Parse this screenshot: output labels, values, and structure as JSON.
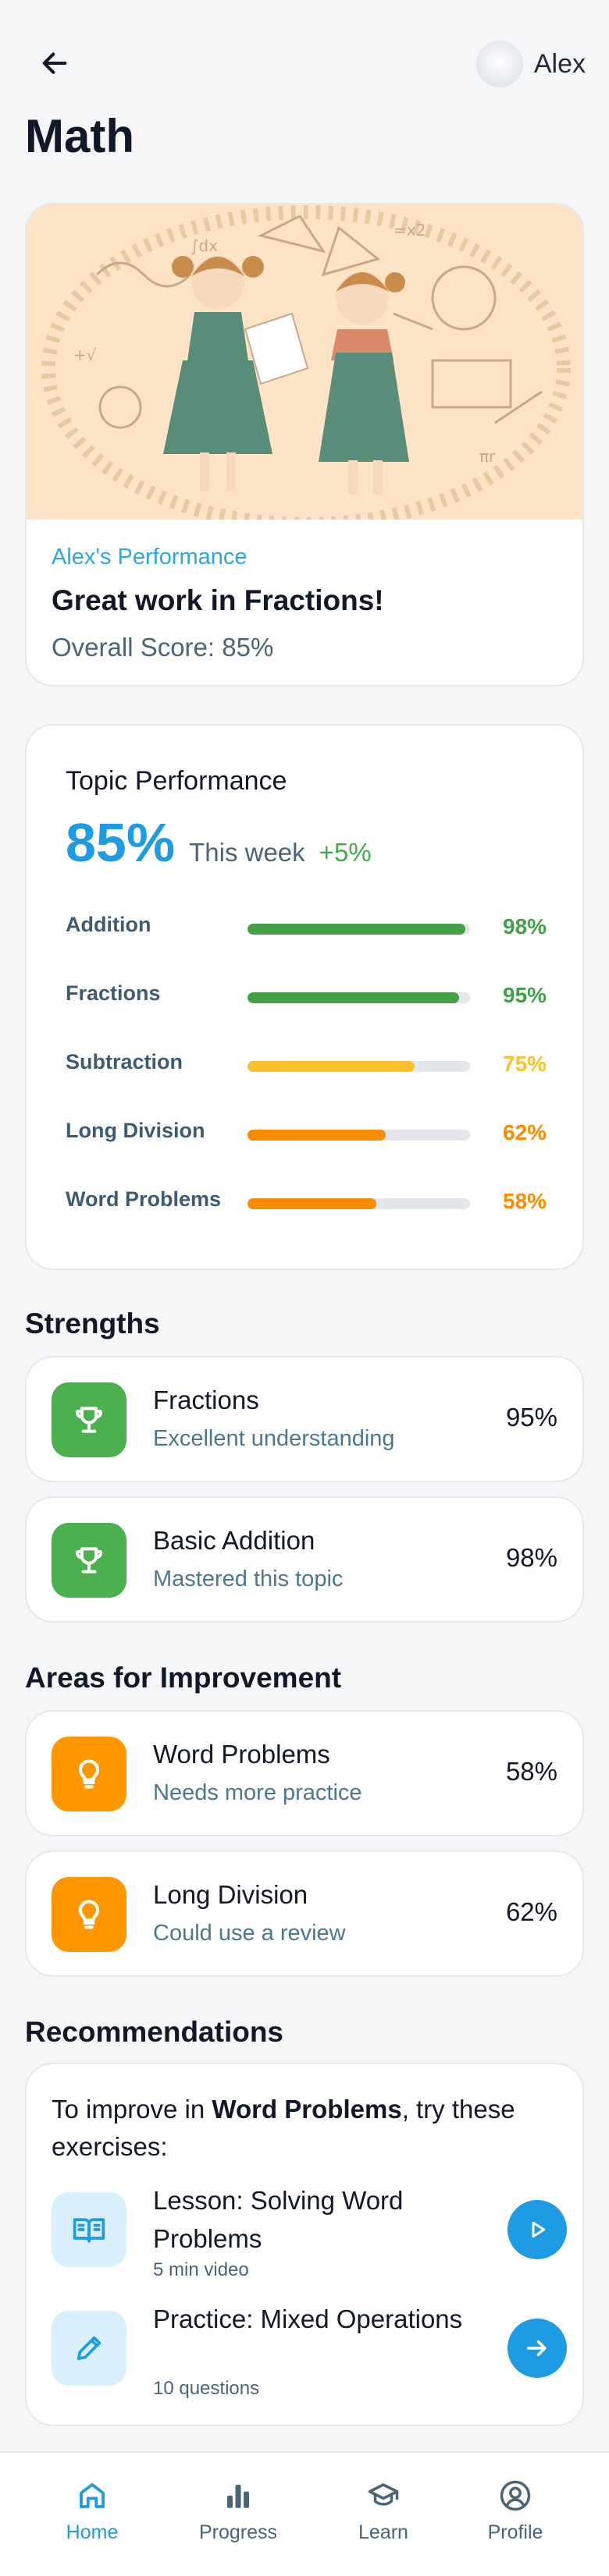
{
  "header": {
    "user_name": "Alex"
  },
  "page_title": "Math",
  "hero": {
    "subtitle": "Alex's Performance",
    "title": "Great work in Fractions!",
    "score": "Overall Score: 85%"
  },
  "topic_performance": {
    "title": "Topic Performance",
    "score": "85%",
    "week_label": "This week",
    "week_delta": "+5%",
    "items": [
      {
        "label": "Addition",
        "pct": "98%",
        "value": 98,
        "color": "#43a047"
      },
      {
        "label": "Fractions",
        "pct": "95%",
        "value": 95,
        "color": "#43a047"
      },
      {
        "label": "Subtraction",
        "pct": "75%",
        "value": 75,
        "color": "#fbc02d"
      },
      {
        "label": "Long Division",
        "pct": "62%",
        "value": 62,
        "color": "#fb8c00"
      },
      {
        "label": "Word Problems",
        "pct": "58%",
        "value": 58,
        "color": "#fb8c00"
      }
    ]
  },
  "strengths": {
    "title": "Strengths",
    "items": [
      {
        "title": "Fractions",
        "subtitle": "Excellent understanding",
        "pct": "95%",
        "icon": "trophy-icon",
        "color": "#4caf50"
      },
      {
        "title": "Basic Addition",
        "subtitle": "Mastered this topic",
        "pct": "98%",
        "icon": "trophy-icon",
        "color": "#4caf50"
      }
    ]
  },
  "improvement": {
    "title": "Areas for Improvement",
    "items": [
      {
        "title": "Word Problems",
        "subtitle": "Needs more practice",
        "pct": "58%",
        "icon": "lightbulb-icon",
        "color": "#ff9800"
      },
      {
        "title": "Long Division",
        "subtitle": "Could use a review",
        "pct": "62%",
        "icon": "lightbulb-icon",
        "color": "#ff9800"
      }
    ]
  },
  "recommendations": {
    "title": "Recommendations",
    "intro_prefix": "To improve in ",
    "intro_topic": "Word Problems",
    "intro_suffix": ", try these exercises:",
    "items": [
      {
        "title": "Lesson: Solving Word Problems",
        "meta": "5 min video",
        "icon": "book-icon",
        "action_icon": "play-icon"
      },
      {
        "title": "Practice: Mixed Operations",
        "meta": "10 questions",
        "icon": "pencil-icon",
        "action_icon": "arrow-right-icon"
      }
    ]
  },
  "nav": {
    "items": [
      {
        "label": "Home",
        "icon": "home-icon",
        "active": true
      },
      {
        "label": "Progress",
        "icon": "bar-chart-icon",
        "active": false
      },
      {
        "label": "Learn",
        "icon": "graduation-cap-icon",
        "active": false
      },
      {
        "label": "Profile",
        "icon": "user-circle-icon",
        "active": false
      }
    ]
  },
  "colors": {
    "accent": "#1e9be2",
    "success": "#43a047",
    "warning": "#fb8c00",
    "caution": "#fbc02d"
  }
}
